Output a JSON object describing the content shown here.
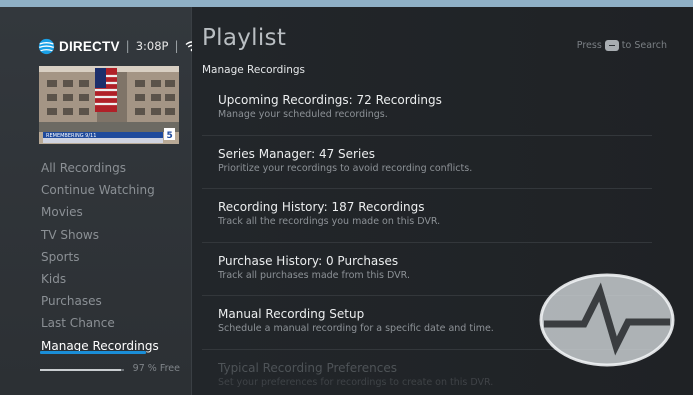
{
  "sidebar": {
    "brand": "DIRECTV",
    "time": "3:08P",
    "thumbnail": {
      "caption": "REMEMBERING 9/11",
      "channel": "5"
    },
    "nav_items": [
      {
        "label": "All Recordings"
      },
      {
        "label": "Continue Watching"
      },
      {
        "label": "Movies"
      },
      {
        "label": "TV Shows"
      },
      {
        "label": "Sports"
      },
      {
        "label": "Kids"
      },
      {
        "label": "Purchases"
      },
      {
        "label": "Last Chance"
      },
      {
        "label": "Manage Recordings"
      }
    ],
    "active_item": "Manage Recordings",
    "storage": {
      "label": "97 % Free",
      "free_fraction": 0.97
    }
  },
  "main": {
    "title": "Playlist",
    "search_hint": {
      "before": "Press",
      "after": "to Search"
    },
    "subtitle": "Manage Recordings",
    "items": [
      {
        "title": "Upcoming Recordings: 72 Recordings",
        "desc": "Manage your scheduled recordings."
      },
      {
        "title": "Series Manager: 47 Series",
        "desc": "Prioritize your recordings to avoid recording conflicts."
      },
      {
        "title": "Recording History: 187 Recordings",
        "desc": "Track all the recordings you made on this DVR."
      },
      {
        "title": "Purchase History: 0 Purchases",
        "desc": "Track all purchases made from this DVR."
      },
      {
        "title": "Manual Recording Setup",
        "desc": "Schedule a manual recording for a specific date and time."
      },
      {
        "title": "Typical Recording Preferences",
        "desc": "Set your preferences for recordings to create on this DVR."
      }
    ]
  },
  "colors": {
    "accent": "#1a8ed8",
    "background": "#1d2023",
    "sidebar": "#30353a"
  }
}
